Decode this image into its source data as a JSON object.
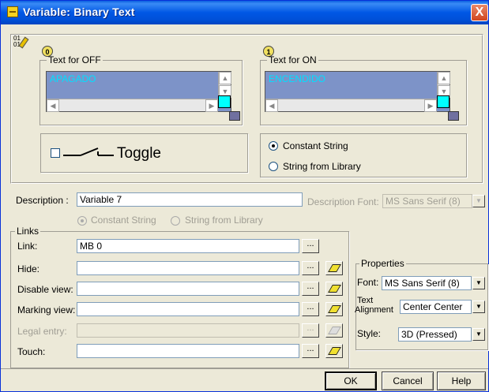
{
  "window": {
    "title": "Variable: Binary Text",
    "close_label": "X"
  },
  "text_off": {
    "legend": "Text for OFF",
    "value": "APAGADO",
    "badge": "0"
  },
  "text_on": {
    "legend": "Text for ON",
    "value": "ENCENDIDO",
    "badge": "1"
  },
  "toggle": {
    "label": "Toggle",
    "checked": false
  },
  "string_mode": {
    "options": [
      "Constant String",
      "String from Library"
    ],
    "selected": "Constant String"
  },
  "description": {
    "label": "Description :",
    "value": "Variable 7",
    "font_label": "Description Font:",
    "font_value": "MS Sans Serif (8)"
  },
  "description_mode": {
    "options": [
      "Constant String",
      "String from Library"
    ],
    "selected": "Constant String"
  },
  "links": {
    "legend": "Links",
    "rows": [
      {
        "label": "Link:",
        "value": "MB 0",
        "enabled": true
      },
      {
        "label": "Hide:",
        "value": "",
        "enabled": true
      },
      {
        "label": "Disable view:",
        "value": "",
        "enabled": true
      },
      {
        "label": "Marking view:",
        "value": "",
        "enabled": true
      },
      {
        "label": "Legal entry:",
        "value": "",
        "enabled": false
      },
      {
        "label": "Touch:",
        "value": "",
        "enabled": true
      }
    ],
    "browse_label": "..."
  },
  "properties": {
    "legend": "Properties",
    "font_label": "Font:",
    "font_value": "MS Sans Serif (8)",
    "alignment_label_1": "Text",
    "alignment_label_2": "Alignment",
    "alignment_value": "Center Center",
    "style_label": "Style:",
    "style_value": "3D (Pressed)"
  },
  "buttons": {
    "ok": "OK",
    "cancel": "Cancel",
    "help": "Help"
  },
  "colors": {
    "title_bar": "#0057e5",
    "text_bg": "#7d93c8",
    "text_fg": "#00e0ff",
    "swatch": "#00ffff"
  }
}
